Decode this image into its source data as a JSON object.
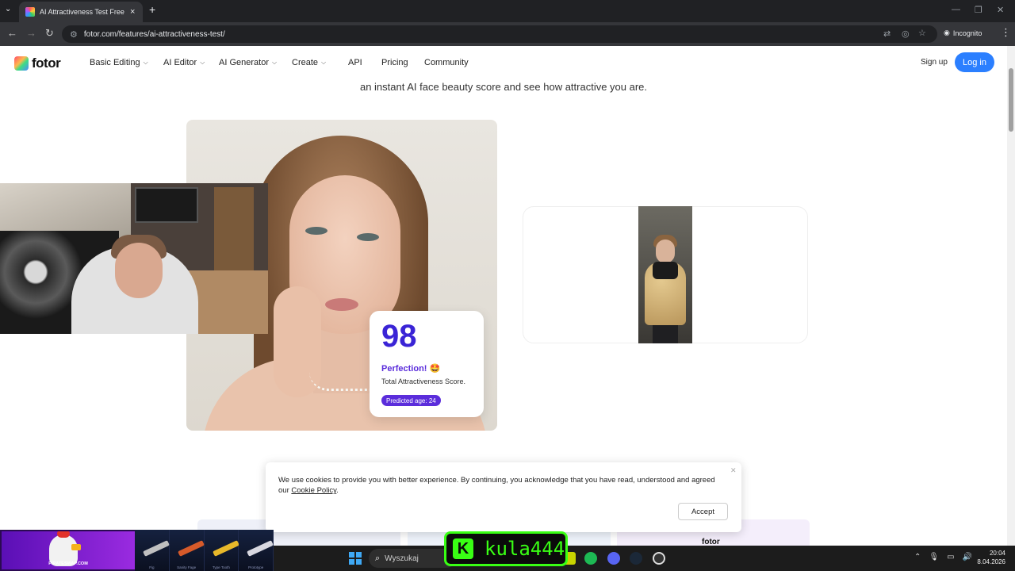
{
  "browser": {
    "tab_title": "AI Attractiveness Test Free - An",
    "url": "fotor.com/features/ai-attractiveness-test/",
    "incognito_label": "Incognito"
  },
  "site": {
    "logo_text": "fotor",
    "nav": [
      {
        "label": "Basic Editing",
        "dropdown": true
      },
      {
        "label": "AI Editor",
        "dropdown": true
      },
      {
        "label": "AI Generator",
        "dropdown": true
      },
      {
        "label": "Create",
        "dropdown": true
      },
      {
        "label": "API",
        "dropdown": false
      },
      {
        "label": "Pricing",
        "dropdown": false
      },
      {
        "label": "Community",
        "dropdown": false
      }
    ],
    "signup_label": "Sign up",
    "login_label": "Log in",
    "accent": "#2b7fff"
  },
  "hero": {
    "subtitle": "an instant AI face beauty score and see how attractive you are.",
    "score": "98",
    "perfection": "Perfection! 🤩",
    "total_label": "Total Attractiveness Score.",
    "predicted_age": "Predicted age: 24",
    "score_color": "#3a24d6"
  },
  "cookie": {
    "text": "We use cookies to provide you with better experience. By continuing, you acknowledge that you have read, understood and agreed our ",
    "link": "Cookie Policy",
    "period": ".",
    "accept_label": "Accept",
    "close_icon": "close-icon"
  },
  "lower": {
    "fotor_label": "fotor"
  },
  "taskbar": {
    "search_placeholder": "Wyszukaj",
    "time": "20:04",
    "date": "8.04.2026"
  },
  "overlays": {
    "brand": "PIRATESWAP.COM",
    "skins": [
      "Fig",
      "Sanity Fage",
      "Type Tooth",
      "Prototype"
    ],
    "streamer_name": "kula444",
    "streamer_color": "#39ff14"
  }
}
